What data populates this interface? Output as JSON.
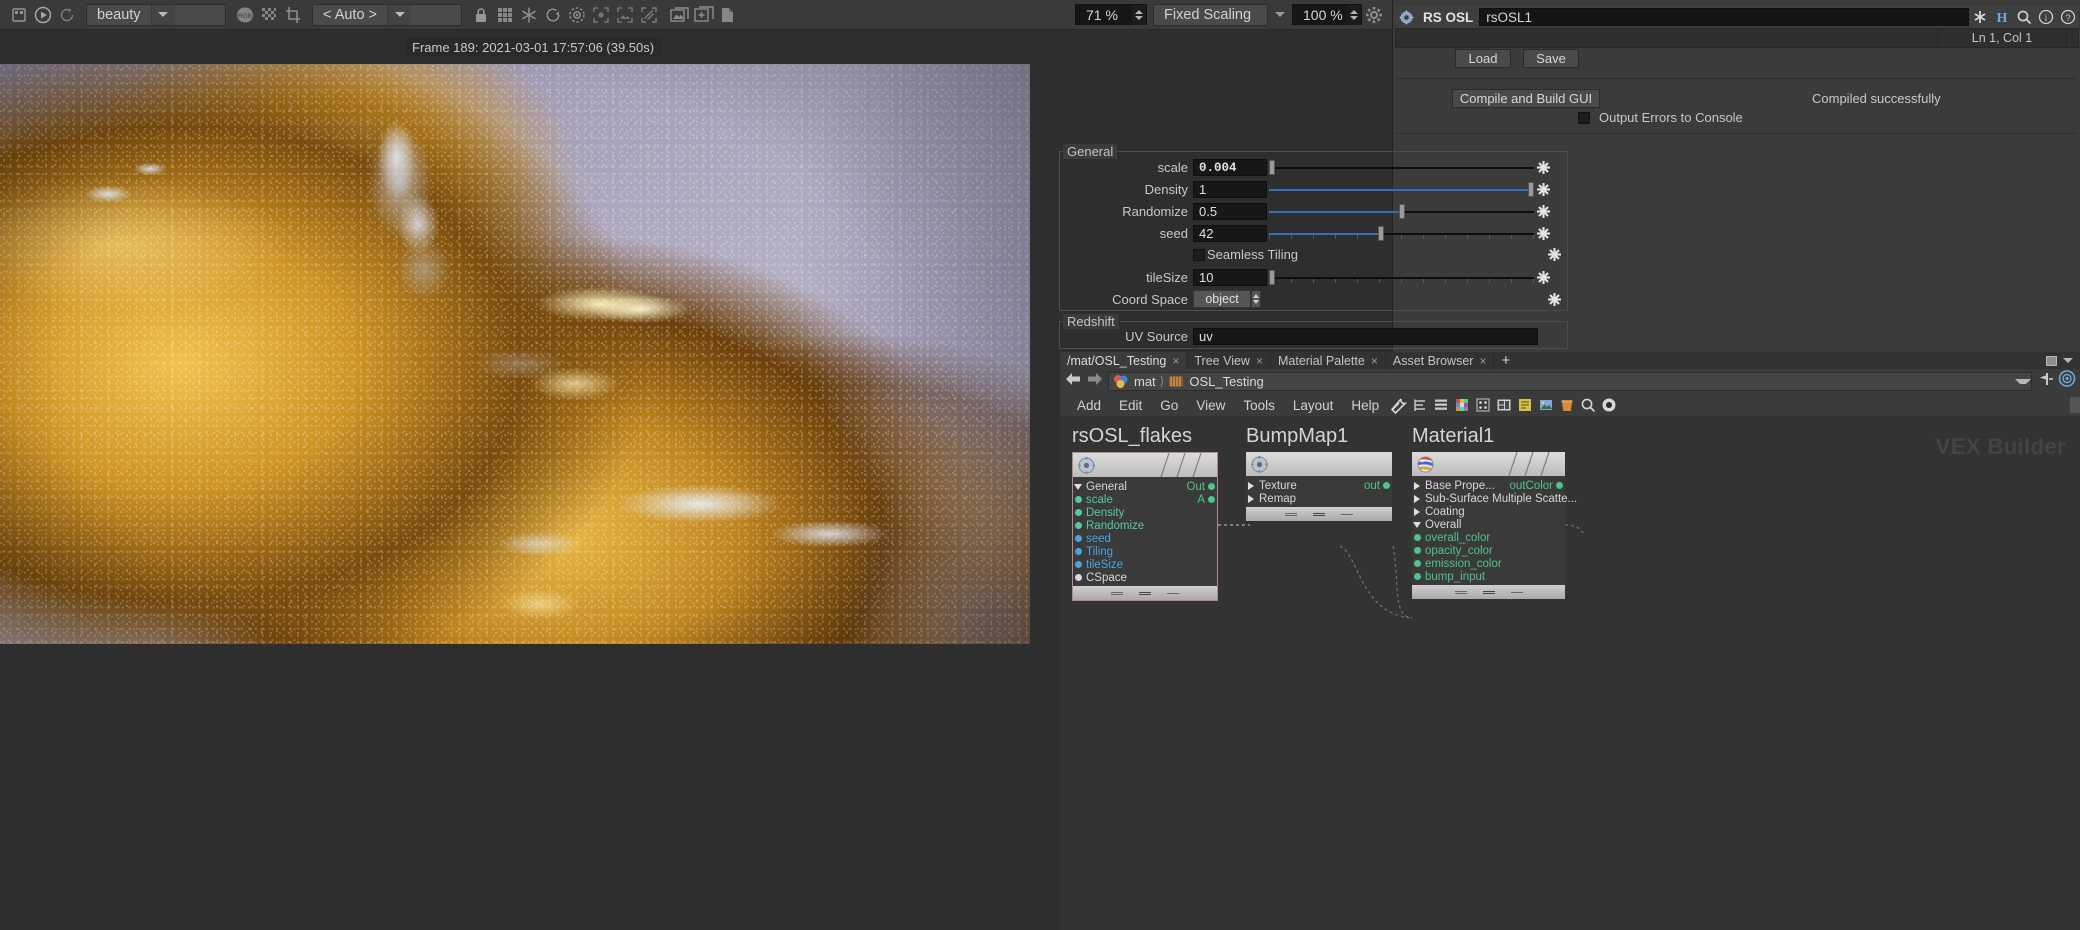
{
  "render_view": {
    "toolbar": {
      "play_icon": "play-icon",
      "reload_icon": "reload-icon",
      "aov_value": "beauty",
      "rgb_icon": "rgb-channel-icon",
      "alpha_icon": "checker-alpha-icon",
      "crop_icon": "crop-icon",
      "range_value": "< Auto >",
      "lock_icon": "lock-icon",
      "grid_icon": "grid-icon",
      "snowflake_icon": "snowflake-icon",
      "rotate_icon": "rotate-icon",
      "target_icon": "target-icon",
      "region_icon": "region-icon",
      "crop_region_icon": "crop-region-icon",
      "diagonal_icon": "diagonal-region-icon",
      "image_icon": "image-icon",
      "add_image_icon": "add-image-icon",
      "copy_icon": "copy-image-icon",
      "zoom_value": "71 %",
      "scaling_mode": "Fixed Scaling",
      "scaling_value": "100 %",
      "settings_icon": "gear-icon"
    },
    "frame_info": "Frame 189: 2021-03-01 17:57:06 (39.50s)"
  },
  "osl_panel": {
    "gear_icon": "gear-icon",
    "title": "RS OSL",
    "node_name": "rsOSL1",
    "header_icons": [
      "asterisk-icon",
      "houdini-h-icon",
      "search-icon",
      "info-icon",
      "help-icon"
    ],
    "line_col": "Ln 1, Col 1",
    "load_label": "Load",
    "save_label": "Save",
    "compile_label": "Compile and Build GUI",
    "compile_status": "Compiled successfully",
    "output_errors_label": "Output Errors to Console",
    "output_errors_checked": false,
    "groups": [
      {
        "label": "General",
        "params": [
          {
            "name": "scale",
            "value": "0.004",
            "type": "slider",
            "fill": 0,
            "handle": 0,
            "ticks": false,
            "mono": true
          },
          {
            "name": "Density",
            "value": "1",
            "type": "slider",
            "fill": 100,
            "handle": 100,
            "ticks": false,
            "mono": false
          },
          {
            "name": "Randomize",
            "value": "0.5",
            "type": "slider",
            "fill": 50,
            "handle": 50,
            "ticks": false,
            "mono": false
          },
          {
            "name": "seed",
            "value": "42",
            "type": "slider",
            "fill": 42,
            "handle": 42,
            "ticks": true,
            "mono": false
          },
          {
            "name": "Seamless Tiling",
            "value": "",
            "type": "checkbox",
            "checked": false
          },
          {
            "name": "tileSize",
            "value": "10",
            "type": "slider",
            "fill": 0,
            "handle": 0,
            "ticks": true,
            "mono": false
          },
          {
            "name": "Coord Space",
            "value": "object",
            "type": "menu"
          }
        ]
      },
      {
        "label": "Redshift",
        "params": [
          {
            "name": "UV Source",
            "value": "uv",
            "type": "text"
          }
        ]
      }
    ]
  },
  "network_editor": {
    "tabs": [
      {
        "label": "/mat/OSL_Testing",
        "active": true,
        "closable": true
      },
      {
        "label": "Tree View",
        "active": false,
        "closable": true
      },
      {
        "label": "Material Palette",
        "active": false,
        "closable": true
      },
      {
        "label": "Asset Browser",
        "active": false,
        "closable": true
      }
    ],
    "add_tab_icon": "plus-icon",
    "maximize_icon": "maximize-icon",
    "tab_menu_icon": "chevron-down-icon",
    "back_icon": "back-arrow-icon",
    "forward_icon": "forward-arrow-icon",
    "breadcrumb": [
      {
        "icon": "mat-context-icon",
        "label": "mat"
      },
      {
        "icon": "subnet-icon",
        "label": "OSL_Testing"
      }
    ],
    "path_dropdown_icon": "chevron-down-icon",
    "pin_icon": "pin-icon",
    "display_icon": "display-flag-icon",
    "menu": [
      "Add",
      "Edit",
      "Go",
      "View",
      "Tools",
      "Layout",
      "Help"
    ],
    "menu_icons": [
      "tools-icon",
      "list-icon",
      "layers-icon",
      "palette-icon",
      "points-icon",
      "layout-icon",
      "notes-icon",
      "image-icon",
      "bucket-icon",
      "search-icon",
      "eye-icon"
    ],
    "watermark": "VEX Builder",
    "nodes": [
      {
        "title": "rsOSL_flakes",
        "icon": "gear-node-icon",
        "selected": true,
        "rows": [
          {
            "label": "General",
            "marker": "tri-down",
            "color": "#d7d7d7",
            "out": "Out",
            "out_color": "#4fc38a"
          },
          {
            "label": "scale",
            "marker": "dot",
            "color": "#56c8a8",
            "out": "A",
            "out_color": "#4fc38a"
          },
          {
            "label": "Density",
            "marker": "dot",
            "color": "#56c8a8",
            "out": ""
          },
          {
            "label": "Randomize",
            "marker": "dot",
            "color": "#56c8a8",
            "out": ""
          },
          {
            "label": "seed",
            "marker": "dot",
            "color": "#4aa3e0",
            "out": ""
          },
          {
            "label": "Tiling",
            "marker": "dot",
            "color": "#4aa3e0",
            "out": ""
          },
          {
            "label": "tileSize",
            "marker": "dot",
            "color": "#4aa3e0",
            "out": ""
          },
          {
            "label": "CSpace",
            "marker": "dot",
            "color": "#dadada",
            "out": ""
          }
        ]
      },
      {
        "title": "BumpMap1",
        "icon": "gear-node-icon",
        "selected": false,
        "rows": [
          {
            "label": "Texture",
            "marker": "tri-right",
            "color": "#d7d7d7",
            "out": "out",
            "out_color": "#4fc38a"
          },
          {
            "label": "Remap",
            "marker": "tri-right",
            "color": "#d7d7d7",
            "out": ""
          }
        ]
      },
      {
        "title": "Material1",
        "icon": "material-ball-icon",
        "selected": false,
        "rows": [
          {
            "label": "Base Prope...",
            "marker": "tri-right",
            "color": "#d7d7d7",
            "out": "outColor",
            "out_color": "#4fc38a"
          },
          {
            "label": "Sub-Surface Multiple Scatte...",
            "marker": "tri-right",
            "color": "#d7d7d7",
            "out": ""
          },
          {
            "label": "Coating",
            "marker": "tri-right",
            "color": "#d7d7d7",
            "out": ""
          },
          {
            "label": "Overall",
            "marker": "tri-down",
            "color": "#d7d7d7",
            "out": ""
          },
          {
            "label": "overall_color",
            "marker": "dot",
            "color": "#4fc38a",
            "out": ""
          },
          {
            "label": "opacity_color",
            "marker": "dot",
            "color": "#4fc38a",
            "out": ""
          },
          {
            "label": "emission_color",
            "marker": "dot",
            "color": "#4fc38a",
            "out": ""
          },
          {
            "label": "bump_input",
            "marker": "dot",
            "color": "#4fc38a",
            "out": ""
          }
        ]
      }
    ]
  },
  "colors": {
    "accent_blue": "#2f6fbd",
    "node_green": "#4fc38a",
    "node_teal": "#56c8a8",
    "node_blue": "#4aa3e0",
    "panel_bg": "#3b3b3b",
    "canvas_bg": "#333333",
    "selection": "#b08a8f"
  }
}
